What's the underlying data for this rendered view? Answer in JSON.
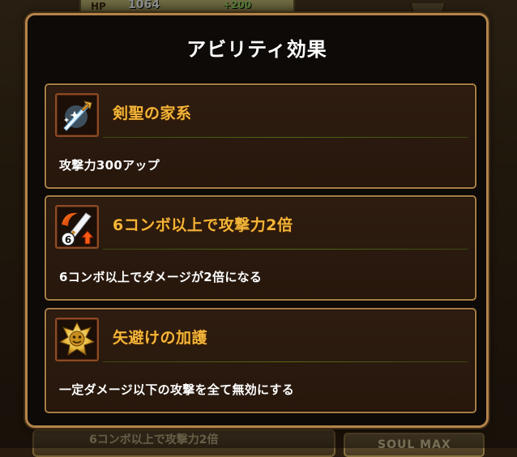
{
  "background": {
    "hp_label": "HP",
    "hp_value": "1064",
    "hp_bonus": "+200",
    "bottom_text": "6コンボ以上で攻撃力2倍",
    "soul_max": "SOUL MAX"
  },
  "dialog": {
    "title": "アビリティ効果"
  },
  "abilities": [
    {
      "icon": "sword-sparkle-icon",
      "name": "剣聖の家系",
      "description": "攻撃力300アップ"
    },
    {
      "icon": "six-combo-attack-up-icon",
      "name": "6コンボ以上で攻撃力2倍",
      "description": "6コンボ以上でダメージが2倍になる"
    },
    {
      "icon": "golden-shield-emblem-icon",
      "name": "矢避けの加護",
      "description": "一定ダメージ以下の攻撃を全て無効にする"
    }
  ],
  "colors": {
    "card_border": "#a77d46",
    "ability_name": "#f3b53a",
    "dialog_border": "#b3844a"
  }
}
